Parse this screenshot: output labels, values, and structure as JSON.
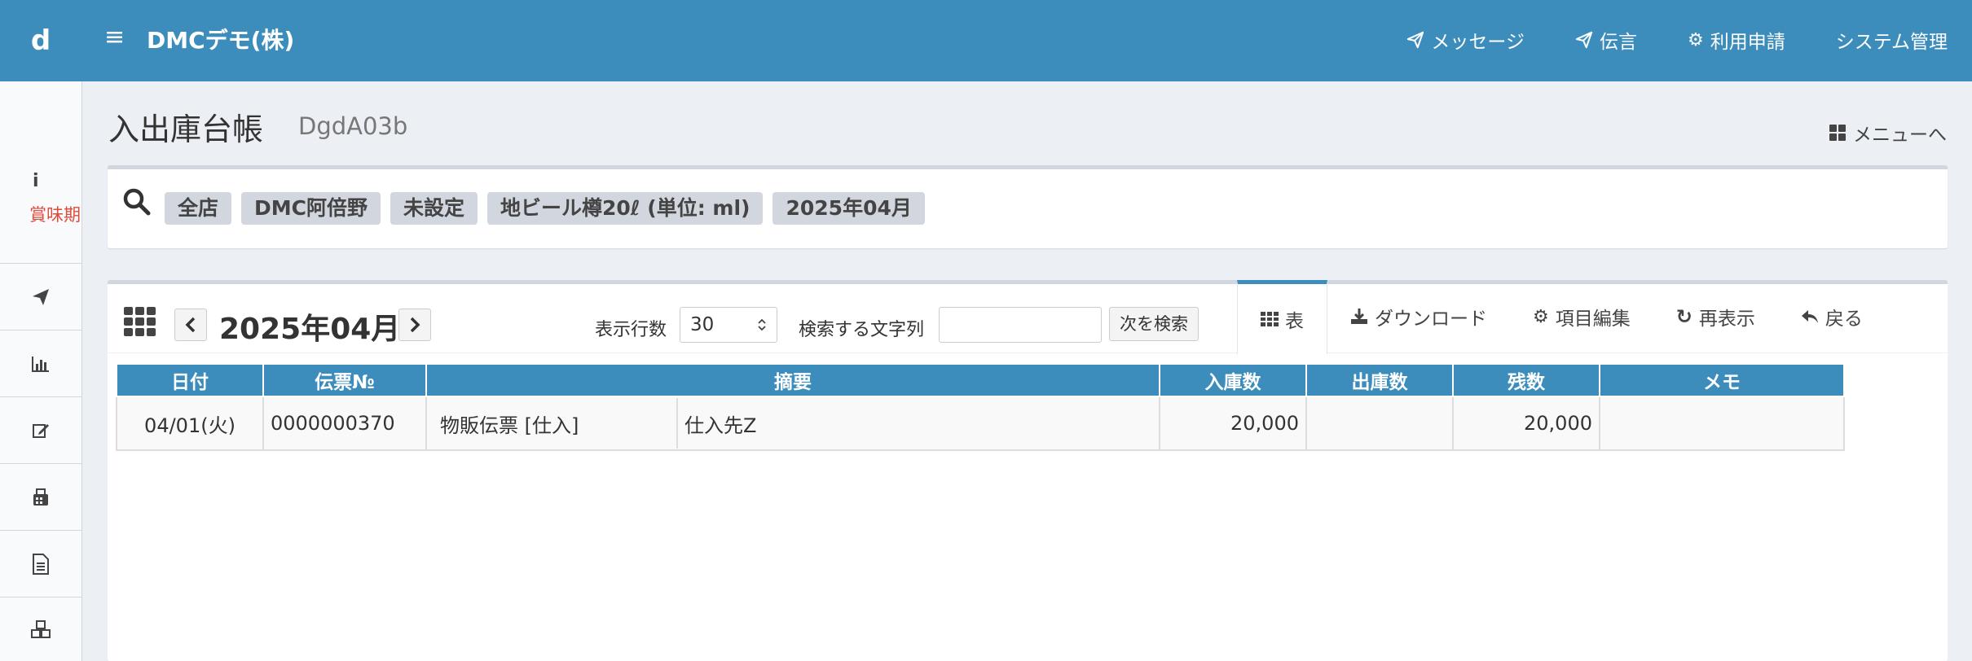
{
  "app": {
    "logo": "d",
    "company": "DMCデモ(株)",
    "nav": [
      {
        "label": "メッセージ",
        "icon": "paper-plane-icon"
      },
      {
        "label": "伝言",
        "icon": "paper-plane-icon"
      },
      {
        "label": "利用申請",
        "icon": "gear-icon"
      },
      {
        "label": "システム管理",
        "icon": ""
      }
    ]
  },
  "sidebar": {
    "info_icon": "i",
    "info_label": "賞味期",
    "items": [
      {
        "icon": "paper-plane-icon"
      },
      {
        "icon": "bar-chart-icon"
      },
      {
        "icon": "edit-icon"
      },
      {
        "icon": "fax-icon"
      },
      {
        "icon": "document-icon"
      },
      {
        "icon": "cubes-icon"
      }
    ]
  },
  "page": {
    "title": "入出庫台帳",
    "subtitle": "DgdA03b",
    "menu_link": "メニューへ"
  },
  "filters": [
    "全店",
    "DMC阿倍野",
    "未設定",
    "地ビール樽20ℓ (単位: ml)",
    "2025年04月"
  ],
  "toolbar": {
    "month": "2025年04月",
    "rows_label": "表示行数",
    "rows_value": "30",
    "search_label": "検索する文字列",
    "search_value": "",
    "next_button": "次を検索",
    "tabs": [
      {
        "label": "表",
        "icon": "table-icon",
        "active": true
      },
      {
        "label": "ダウンロード",
        "icon": "download-icon"
      },
      {
        "label": "項目編集",
        "icon": "gear-icon"
      },
      {
        "label": "再表示",
        "icon": "refresh-icon"
      },
      {
        "label": "戻る",
        "icon": "reply-icon"
      }
    ]
  },
  "table": {
    "headers": [
      "日付",
      "伝票№",
      "摘要",
      "入庫数",
      "出庫数",
      "残数",
      "メモ"
    ],
    "rows": [
      {
        "date": "04/01(火)",
        "slip_no": "0000000370",
        "summary_type": "物販伝票 [仕入]",
        "summary_party": "仕入先Z",
        "in_qty": "20,000",
        "out_qty": "",
        "balance": "20,000",
        "memo": ""
      }
    ]
  },
  "colors": {
    "header_bar": "#3c8dbc",
    "tag_bg": "#d2d6de",
    "accent_red": "#dd4b39"
  }
}
